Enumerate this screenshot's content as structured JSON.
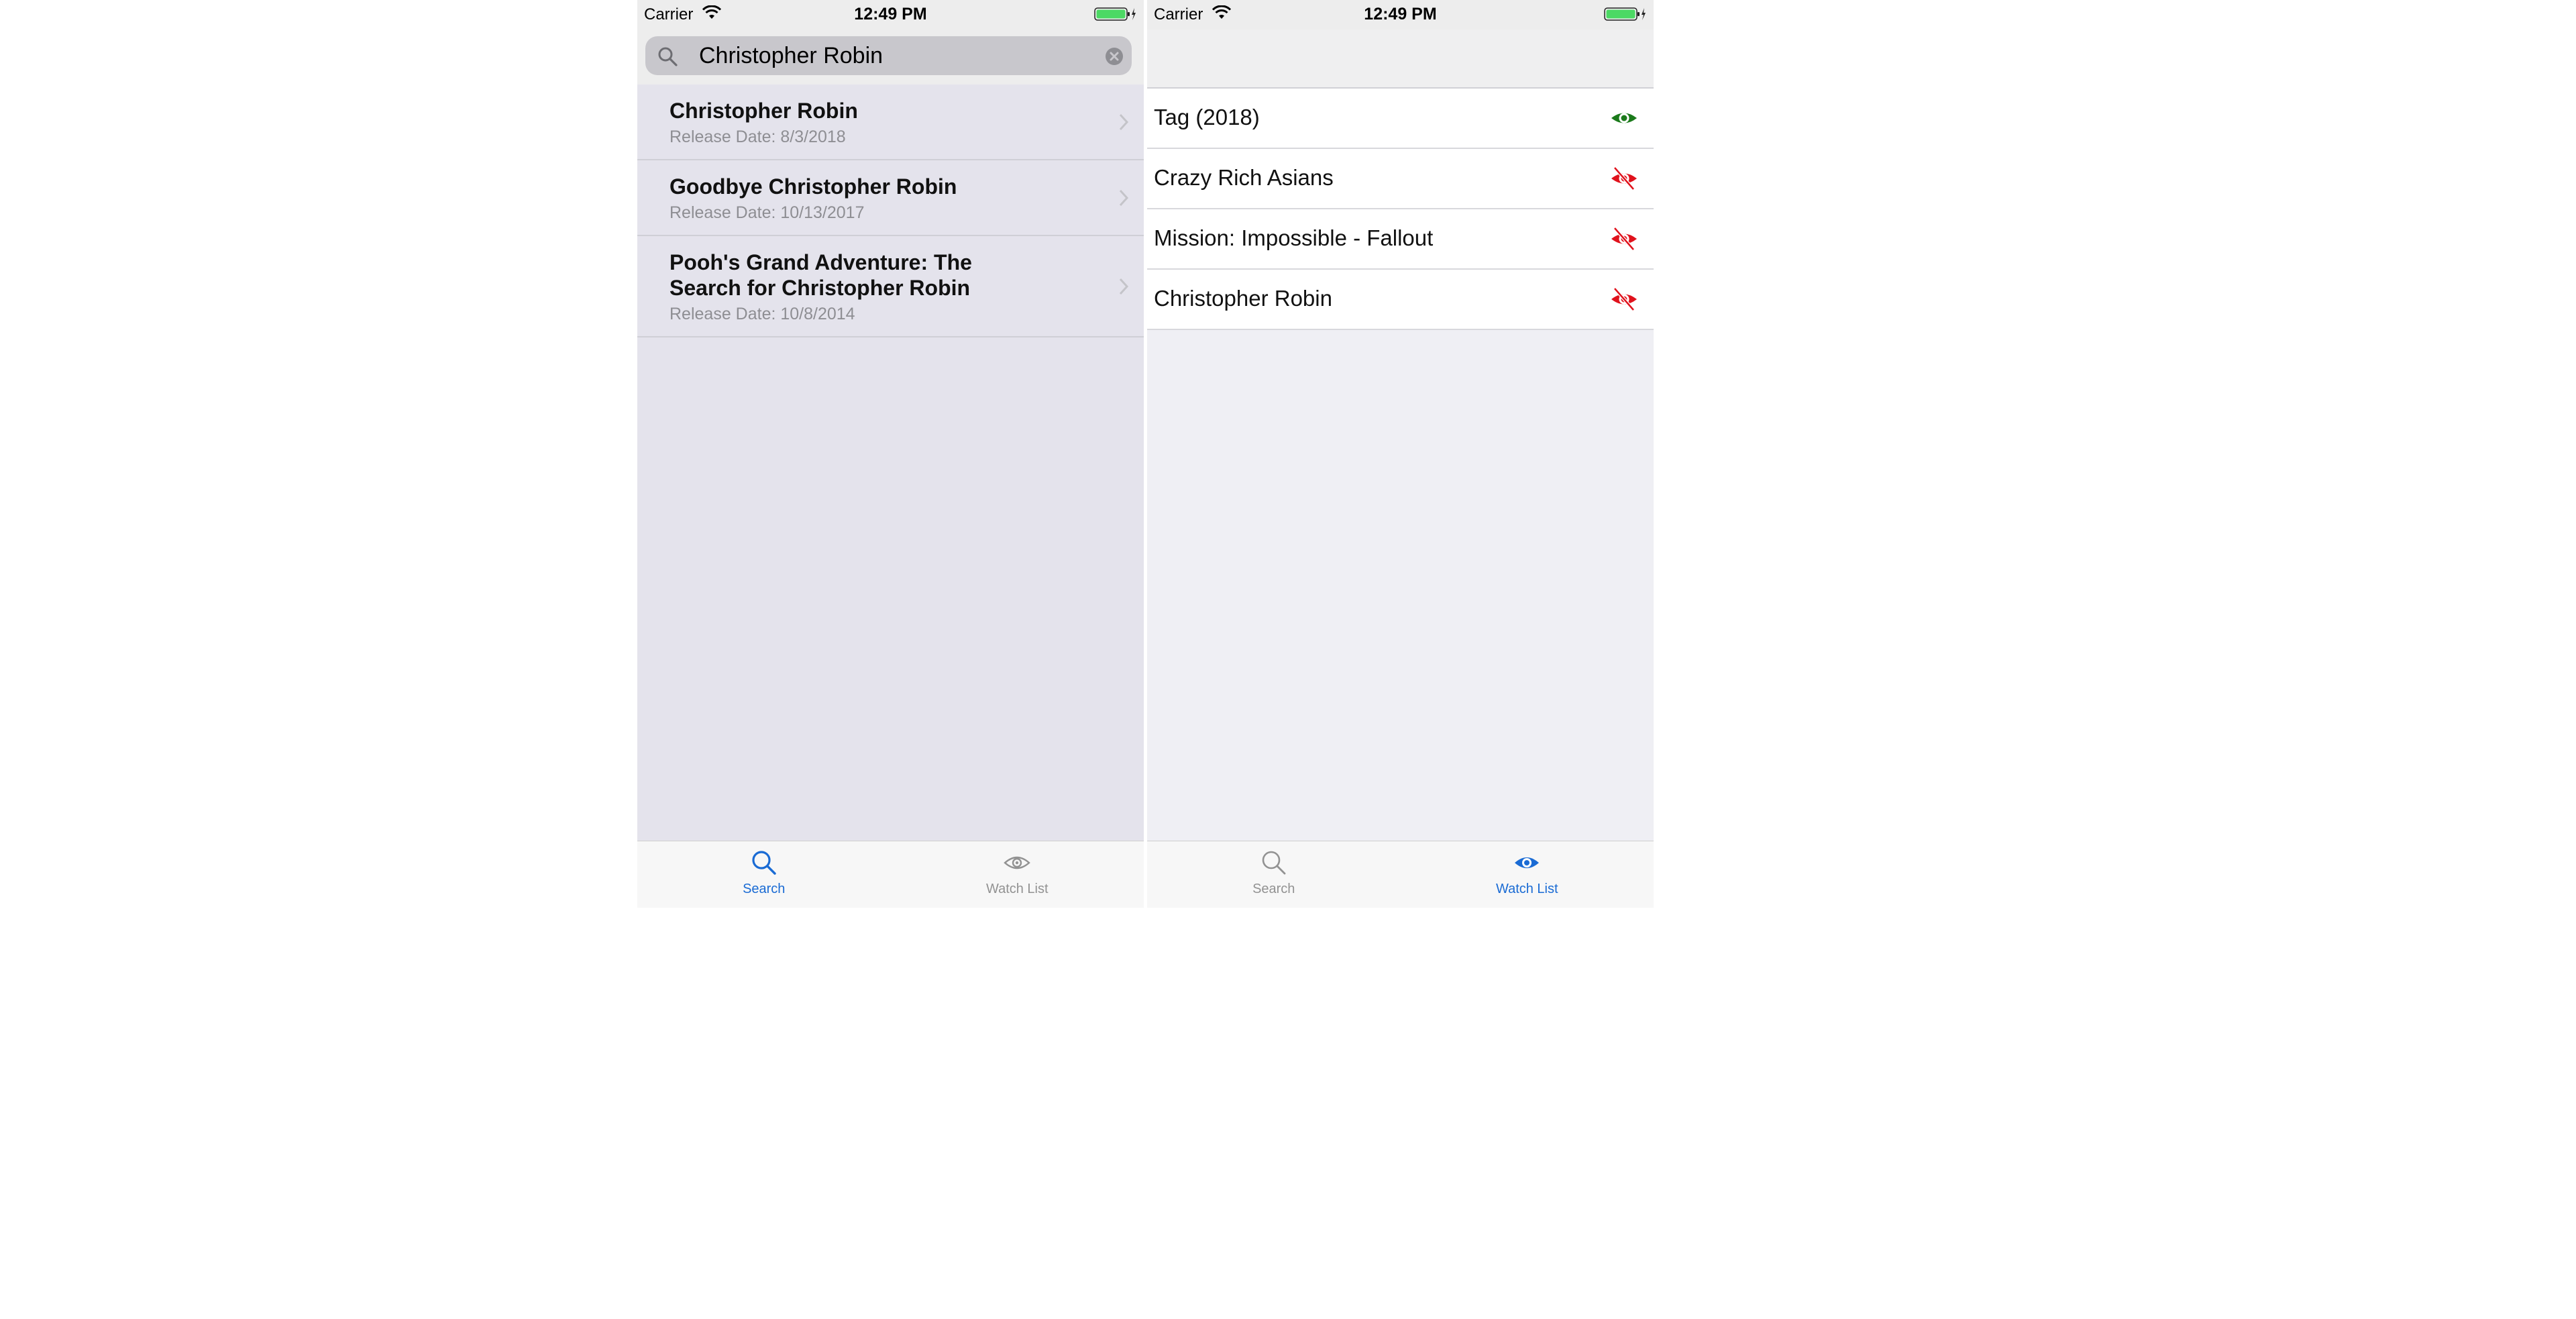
{
  "search_screen": {
    "status_bar": {
      "carrier": "Carrier",
      "time": "12:49 PM"
    },
    "search": {
      "value": "Christopher Robin"
    },
    "results": [
      {
        "title": "Christopher Robin",
        "date": "Release Date: 8/3/2018"
      },
      {
        "title": "Goodbye Christopher Robin",
        "date": "Release Date: 10/13/2017"
      },
      {
        "title": "Pooh's Grand Adventure: The Search for Christopher Robin",
        "date": "Release Date: 10/8/2014"
      }
    ],
    "tabs": [
      {
        "label": "Search",
        "active": true
      },
      {
        "label": "Watch List",
        "active": false
      }
    ]
  },
  "watchlist_screen": {
    "status_bar": {
      "carrier": "Carrier",
      "time": "12:49 PM"
    },
    "items": [
      {
        "title": "Tag (2018)",
        "watched": true
      },
      {
        "title": "Crazy Rich Asians",
        "watched": false
      },
      {
        "title": "Mission: Impossible - Fallout",
        "watched": false
      },
      {
        "title": "Christopher Robin",
        "watched": false
      }
    ],
    "tabs": [
      {
        "label": "Search",
        "active": false
      },
      {
        "label": "Watch List",
        "active": true
      }
    ]
  },
  "colors": {
    "tint": "#1a6bd4",
    "watched": "#1b7a1b",
    "unwatched": "#e0121c",
    "inactive": "#929292",
    "battery": "#4cd964"
  },
  "icons": {
    "search": "magnifying-glass-icon",
    "watch": "eye-icon",
    "unwatched": "eye-slash-icon",
    "disclosure": "chevron-right-icon",
    "clear": "clear-circle-icon"
  }
}
